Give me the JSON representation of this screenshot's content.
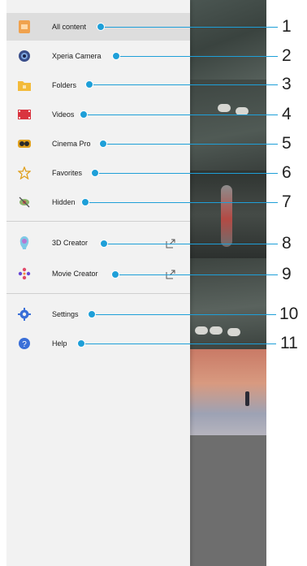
{
  "colors": {
    "callout": "#1e9fd8",
    "drawer_bg": "#f2f2f2",
    "selected_bg": "#dddddd"
  },
  "menu": {
    "items": [
      {
        "label": "All content",
        "icon": "all-content-icon"
      },
      {
        "label": "Xperia Camera",
        "icon": "camera-icon"
      },
      {
        "label": "Folders",
        "icon": "folder-icon"
      },
      {
        "label": "Videos",
        "icon": "video-film-icon"
      },
      {
        "label": "Cinema Pro",
        "icon": "cinema-pro-icon"
      },
      {
        "label": "Favorites",
        "icon": "star-icon"
      },
      {
        "label": "Hidden",
        "icon": "hidden-eye-icon"
      },
      {
        "label": "3D Creator",
        "icon": "3d-creator-icon"
      },
      {
        "label": "Movie Creator",
        "icon": "movie-creator-icon"
      },
      {
        "label": "Settings",
        "icon": "gear-icon"
      },
      {
        "label": "Help",
        "icon": "help-icon"
      }
    ],
    "selected_index": 0
  },
  "callouts": [
    "1",
    "2",
    "3",
    "4",
    "5",
    "6",
    "7",
    "8",
    "9",
    "10",
    "11"
  ]
}
